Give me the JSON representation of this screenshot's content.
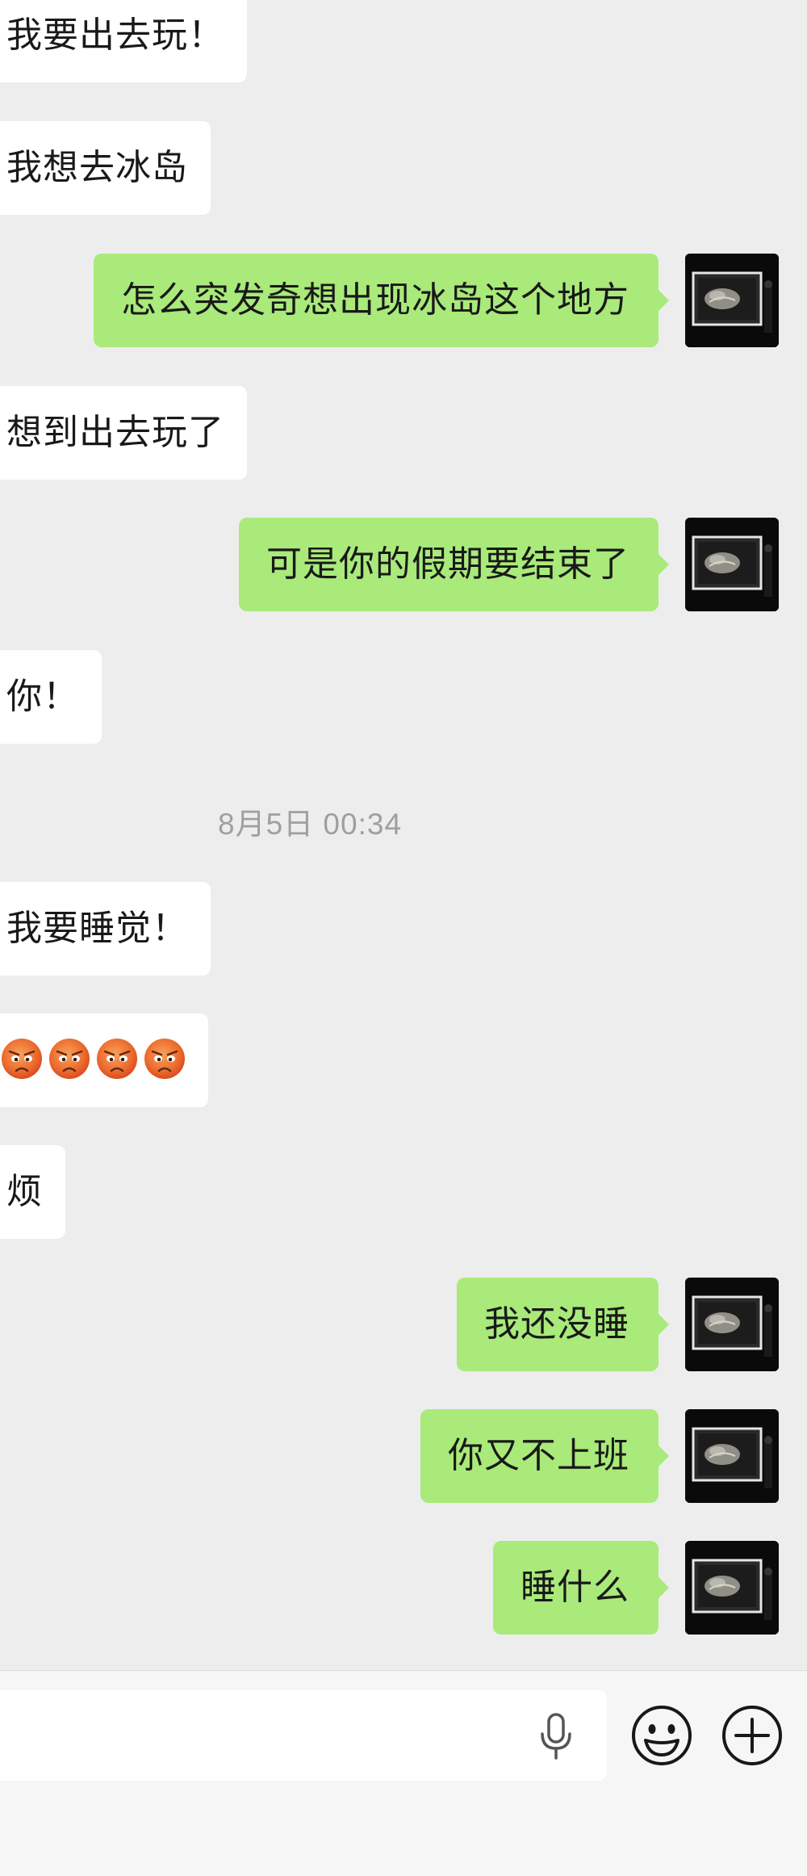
{
  "messages": [
    {
      "side": "in",
      "text": "我要出去玩！"
    },
    {
      "side": "in",
      "text": "我想去冰岛"
    },
    {
      "side": "out",
      "text": "怎么突发奇想出现冰岛这个地方"
    },
    {
      "side": "in",
      "text": "想到出去玩了"
    },
    {
      "side": "out",
      "text": "可是你的假期要结束了"
    },
    {
      "side": "in",
      "text": "你！"
    },
    {
      "side": "in",
      "text": "我要睡觉！"
    },
    {
      "side": "in",
      "emoji": "pouting-face",
      "count": 4
    },
    {
      "side": "in",
      "text": "烦"
    },
    {
      "side": "out",
      "text": "我还没睡"
    },
    {
      "side": "out",
      "text": "你又不上班"
    },
    {
      "side": "out",
      "text": "睡什么"
    }
  ],
  "timestamp": "8月5日 00:34",
  "avatar_image": "dark framed picture",
  "input": {
    "placeholder": "",
    "voice_icon": "microphone-icon",
    "emoji_icon": "smiley-icon",
    "more_icon": "plus-icon"
  },
  "colors": {
    "background": "#ededed",
    "bubble_in": "#ffffff",
    "bubble_out": "#a9ea7a",
    "timestamp": "#9f9f9f"
  }
}
